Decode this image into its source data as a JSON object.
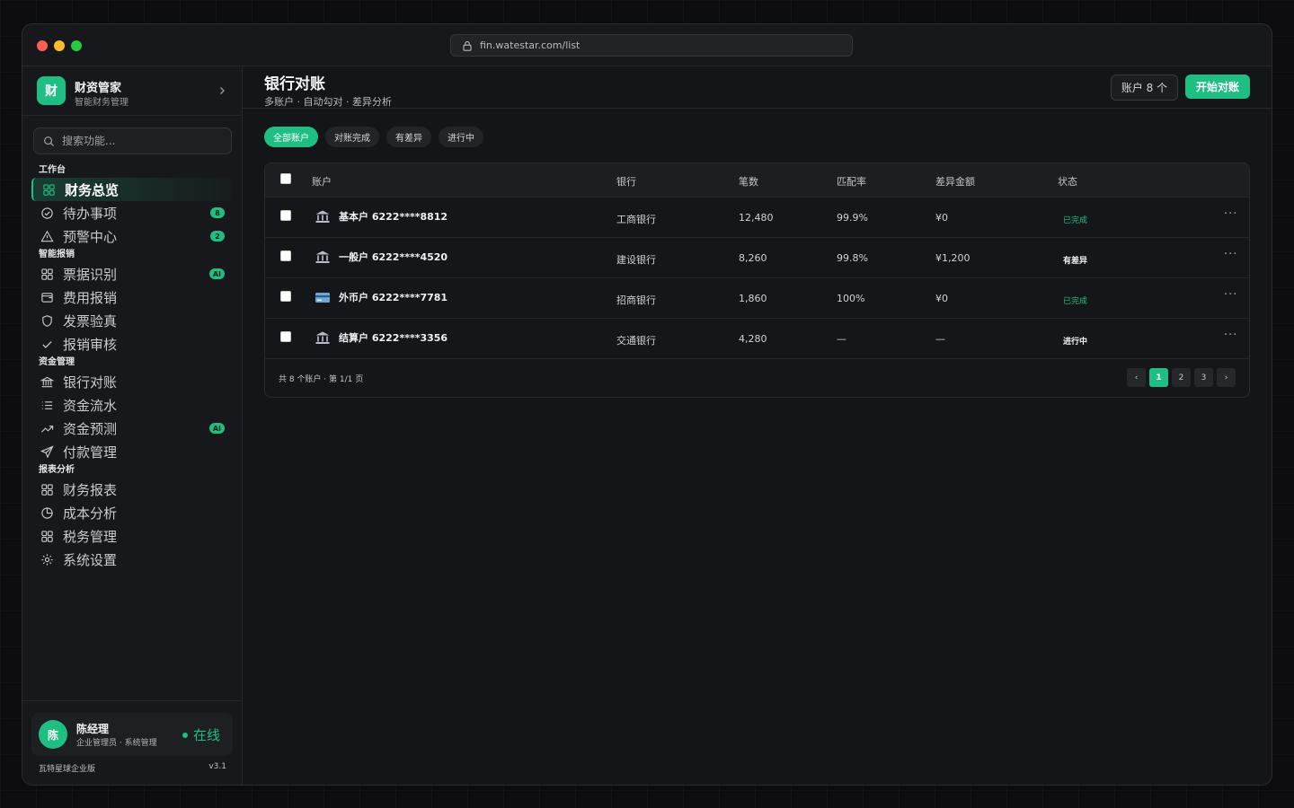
{
  "browser": {
    "url": "fin.watestar.com/list"
  },
  "brand": {
    "logo": "财",
    "name": "财资管家",
    "subtitle": "智能财务管理"
  },
  "search": {
    "placeholder": "搜索功能..."
  },
  "nav": {
    "groups": [
      {
        "label": "工作台",
        "items": [
          {
            "label": "财务总览",
            "icon": "grid-icon",
            "active": true
          },
          {
            "label": "待办事项",
            "icon": "check-circle-icon",
            "badge": "8"
          },
          {
            "label": "预警中心",
            "icon": "warning-icon",
            "badge": "2"
          }
        ]
      },
      {
        "label": "智能报销",
        "items": [
          {
            "label": "票据识别",
            "icon": "grid-icon",
            "badge": "AI"
          },
          {
            "label": "费用报销",
            "icon": "wallet-icon"
          },
          {
            "label": "发票验真",
            "icon": "shield-icon"
          },
          {
            "label": "报销审核",
            "icon": "check-icon"
          }
        ]
      },
      {
        "label": "资金管理",
        "items": [
          {
            "label": "银行对账",
            "icon": "bank-icon"
          },
          {
            "label": "资金流水",
            "icon": "list-icon"
          },
          {
            "label": "资金预测",
            "icon": "trend-icon",
            "badge": "AI"
          },
          {
            "label": "付款管理",
            "icon": "send-icon"
          }
        ]
      },
      {
        "label": "报表分析",
        "items": [
          {
            "label": "财务报表",
            "icon": "grid-icon"
          },
          {
            "label": "成本分析",
            "icon": "pie-icon"
          },
          {
            "label": "税务管理",
            "icon": "grid-icon"
          },
          {
            "label": "系统设置",
            "icon": "gear-icon"
          }
        ]
      }
    ]
  },
  "user": {
    "avatar": "陈",
    "name": "陈经理",
    "role": "企业管理员 · 系统管理",
    "status": "在线"
  },
  "footer": {
    "edition": "瓦特星球企业版",
    "version": "v3.1"
  },
  "page": {
    "title": "银行对账",
    "subtitle": "多账户 · 自动勾对 · 差异分析",
    "count_button": "账户 8 个",
    "start_button": "开始对账"
  },
  "filters": [
    "全部账户",
    "对账完成",
    "有差异",
    "进行中"
  ],
  "table": {
    "headers": {
      "account": "账户",
      "bank": "银行",
      "count": "笔数",
      "rate": "匹配率",
      "diff": "差异金额",
      "status": "状态"
    },
    "rows": [
      {
        "icon": "bank-icon",
        "account": "基本户 6222****8812",
        "bank": "工商银行",
        "count": "12,480",
        "rate": "99.9%",
        "diff": "¥0",
        "status": "已完成",
        "status_type": "done"
      },
      {
        "icon": "bank-icon",
        "account": "一般户 6222****4520",
        "bank": "建设银行",
        "count": "8,260",
        "rate": "99.8%",
        "diff": "¥1,200",
        "status": "有差异",
        "status_type": "diff"
      },
      {
        "icon": "card-icon",
        "account": "外币户 6222****7781",
        "bank": "招商银行",
        "count": "1,860",
        "rate": "100%",
        "diff": "¥0",
        "status": "已完成",
        "status_type": "done"
      },
      {
        "icon": "bank-icon",
        "account": "结算户 6222****3356",
        "bank": "交通银行",
        "count": "4,280",
        "rate": "—",
        "diff": "—",
        "status": "进行中",
        "status_type": "run"
      }
    ],
    "more": "···",
    "footer_info": "共 8 个账户 · 第 1/1 页",
    "pager": {
      "prev": "‹",
      "pages": [
        "1",
        "2",
        "3"
      ],
      "next": "›"
    }
  },
  "colors": {
    "accent": "#1fbf84",
    "background": "#141518",
    "sidebar": "#17181b"
  }
}
